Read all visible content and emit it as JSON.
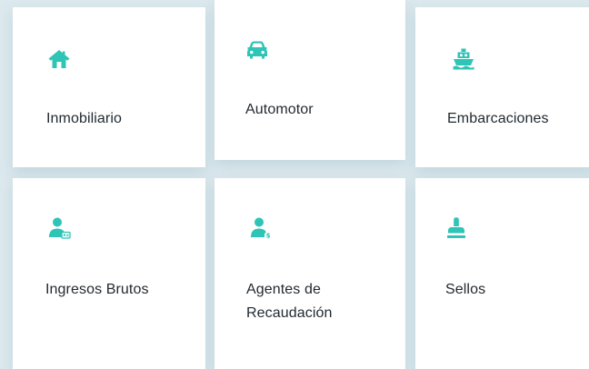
{
  "accent_color": "#2ec4b6",
  "cards": [
    {
      "label": "Inmobiliario",
      "icon": "house-icon"
    },
    {
      "label": "Automotor",
      "icon": "car-icon"
    },
    {
      "label": "Embarcaciones",
      "icon": "ship-icon"
    },
    {
      "label": "Ingresos Brutos",
      "icon": "user-card-icon"
    },
    {
      "label": "Agentes de\nRecaudación",
      "icon": "user-dollar-icon"
    },
    {
      "label": "Sellos",
      "icon": "stamp-icon"
    }
  ]
}
